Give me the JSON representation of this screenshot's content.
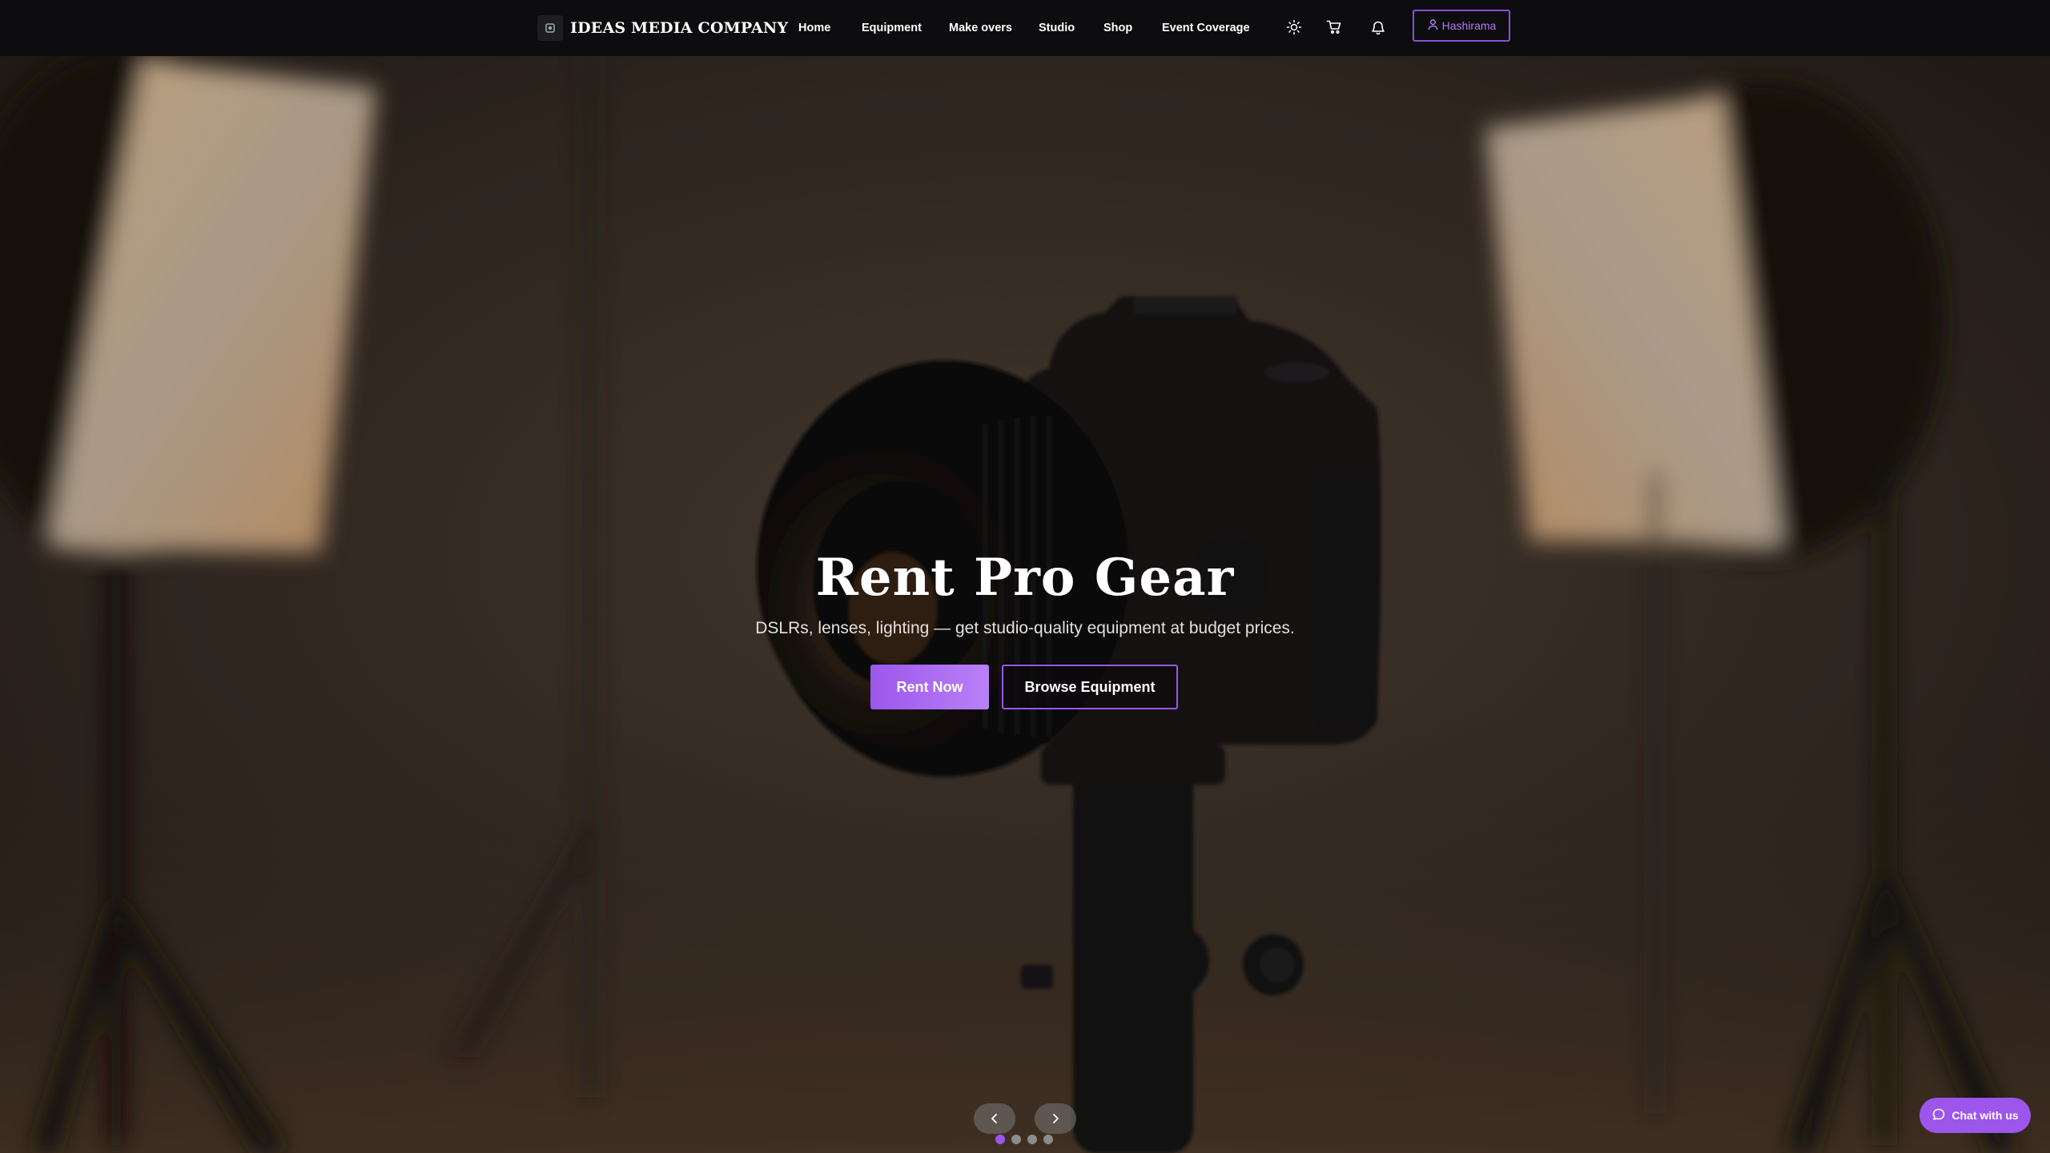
{
  "navbar": {
    "brand": "IDEAS MEDIA COMPANY",
    "links": [
      "Home",
      "Equipment",
      "Make overs",
      "Studio",
      "Shop",
      "Event Coverage"
    ],
    "icons": [
      "sun-icon",
      "cart-icon",
      "bell-icon"
    ],
    "user_label": "Hashirama"
  },
  "hero": {
    "title": "Rent Pro Gear",
    "subtitle": "DSLRs, lenses, lighting — get studio-quality equipment at budget prices.",
    "primary_button": "Rent Now",
    "secondary_button": "Browse Equipment",
    "slide_count": 4,
    "active_slide": 1
  },
  "chat": {
    "label": "Chat with us"
  },
  "colors": {
    "accent": "#9c56ec",
    "navbar_bg": "#0d0d0f"
  }
}
